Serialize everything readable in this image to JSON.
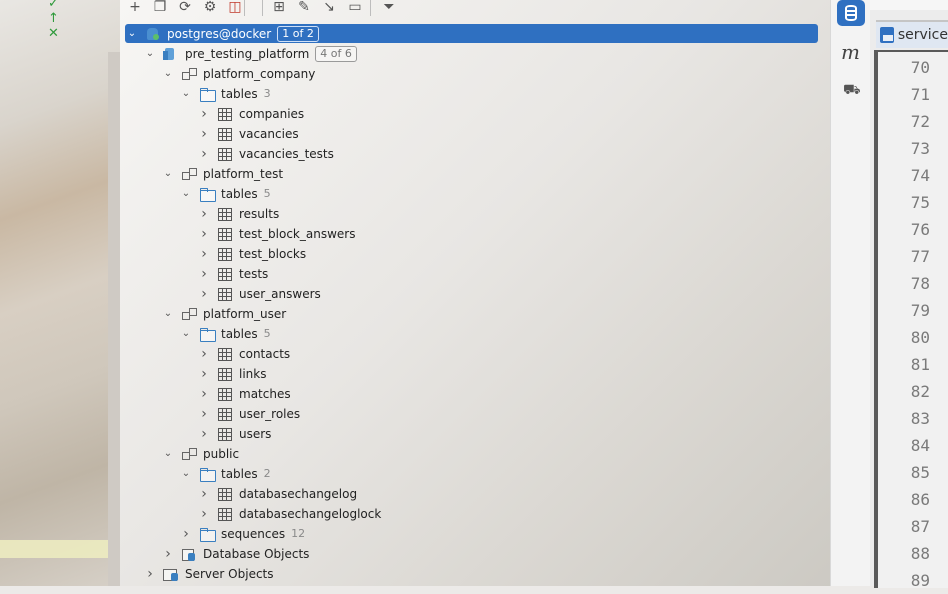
{
  "toolbar": {
    "buttons": [
      {
        "name": "new-connection-icon",
        "glyph": "+"
      },
      {
        "name": "copy-icon",
        "glyph": "❐"
      },
      {
        "name": "refresh-icon",
        "glyph": "⟳"
      },
      {
        "name": "settings-icon",
        "glyph": "⚙"
      },
      {
        "name": "stop-icon",
        "glyph": "◫"
      },
      {
        "name": "table-icon",
        "glyph": "⊞"
      },
      {
        "name": "edit-icon",
        "glyph": "✎"
      },
      {
        "name": "jump-icon",
        "glyph": "↘"
      },
      {
        "name": "console-icon",
        "glyph": "▭"
      },
      {
        "name": "filter-icon",
        "glyph": "⏷"
      }
    ]
  },
  "tree": {
    "root": {
      "label": "postgres@docker",
      "badge": "1 of 2"
    },
    "database": {
      "label": "pre_testing_platform",
      "badge": "4 of 6"
    },
    "schemas": [
      {
        "label": "platform_company",
        "tables_label": "tables",
        "tables_count": "3",
        "tables": [
          "companies",
          "vacancies",
          "vacancies_tests"
        ]
      },
      {
        "label": "platform_test",
        "tables_label": "tables",
        "tables_count": "5",
        "tables": [
          "results",
          "test_block_answers",
          "test_blocks",
          "tests",
          "user_answers"
        ]
      },
      {
        "label": "platform_user",
        "tables_label": "tables",
        "tables_count": "5",
        "tables": [
          "contacts",
          "links",
          "matches",
          "user_roles",
          "users"
        ]
      },
      {
        "label": "public",
        "tables_label": "tables",
        "tables_count": "2",
        "tables": [
          "databasechangelog",
          "databasechangeloglock"
        ],
        "sequences_label": "sequences",
        "sequences_count": "12"
      }
    ],
    "db_objects": "Database Objects",
    "server_objects": "Server Objects"
  },
  "editor": {
    "tab_label": "service",
    "line_numbers": [
      "70",
      "71",
      "72",
      "73",
      "74",
      "75",
      "76",
      "77",
      "78",
      "79",
      "80",
      "81",
      "82",
      "83",
      "84",
      "85",
      "86",
      "87",
      "88",
      "89"
    ]
  }
}
